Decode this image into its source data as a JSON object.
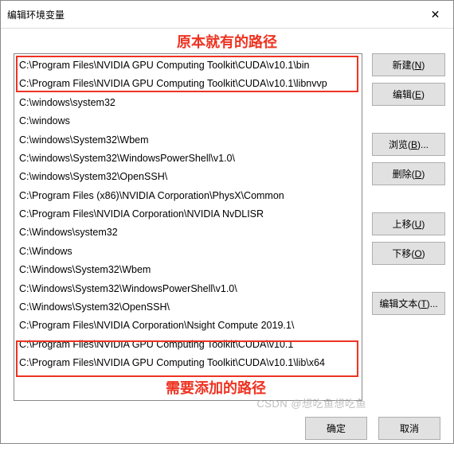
{
  "title": "编辑环境变量",
  "annotations": {
    "top": "原本就有的路径",
    "bottom": "需要添加的路径"
  },
  "list": [
    "C:\\Program Files\\NVIDIA GPU Computing Toolkit\\CUDA\\v10.1\\bin",
    "C:\\Program Files\\NVIDIA GPU Computing Toolkit\\CUDA\\v10.1\\libnvvp",
    "C:\\windows\\system32",
    "C:\\windows",
    "C:\\windows\\System32\\Wbem",
    "C:\\windows\\System32\\WindowsPowerShell\\v1.0\\",
    "C:\\windows\\System32\\OpenSSH\\",
    "C:\\Program Files (x86)\\NVIDIA Corporation\\PhysX\\Common",
    "C:\\Program Files\\NVIDIA Corporation\\NVIDIA NvDLISR",
    "C:\\Windows\\system32",
    "C:\\Windows",
    "C:\\Windows\\System32\\Wbem",
    "C:\\Windows\\System32\\WindowsPowerShell\\v1.0\\",
    "C:\\Windows\\System32\\OpenSSH\\",
    "C:\\Program Files\\NVIDIA Corporation\\Nsight Compute 2019.1\\",
    "C:\\Program Files\\NVIDIA GPU Computing Toolkit\\CUDA\\v10.1",
    "C:\\Program Files\\NVIDIA GPU Computing Toolkit\\CUDA\\v10.1\\lib\\x64"
  ],
  "buttons": {
    "new": "新建(N)",
    "edit": "编辑(E)",
    "browse": "浏览(B)...",
    "delete": "删除(D)",
    "moveup": "上移(U)",
    "movedown": "下移(O)",
    "edittext": "编辑文本(T)...",
    "ok": "确定",
    "cancel": "取消"
  },
  "watermark": "CSDN @想吃鱼想吃鱼"
}
